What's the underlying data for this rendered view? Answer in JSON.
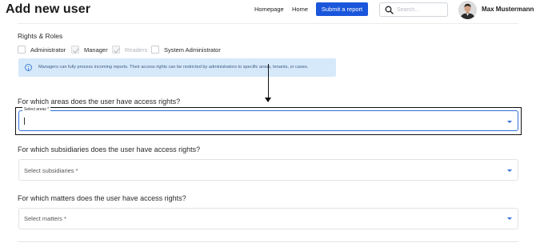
{
  "header": {
    "title": "Add new user",
    "nav": {
      "homepage": "Homepage",
      "home": "Home"
    },
    "submit_label": "Submit a report",
    "search_placeholder": "Search...",
    "user_name": "Max Mustermann"
  },
  "roles": {
    "title": "Rights & Roles",
    "items": [
      {
        "label": "Administrator",
        "checked": false,
        "disabled": false
      },
      {
        "label": "Manager",
        "checked": true,
        "disabled": true
      },
      {
        "label": "Readers",
        "checked": true,
        "disabled": true
      },
      {
        "label": "System Administrator",
        "checked": false,
        "disabled": false
      }
    ],
    "info": "Managers can fully process incoming reports. Their access rights can be restricted by administrators to specific areas, tenants, or cases."
  },
  "areas": {
    "question": "For which areas does the user have access rights?",
    "field_label": "Select areas *",
    "value": ""
  },
  "subsidiaries": {
    "question": "For which subsidiaries does the user have access rights?",
    "placeholder": "Select subsidiaries *"
  },
  "matters": {
    "question": "For which matters does the user have access rights?",
    "placeholder": "Select matters *"
  },
  "colors": {
    "accent": "#1a56db",
    "focus_border": "#2f6fd8",
    "info_bg": "#d6e9fb",
    "annotation": "#111111"
  },
  "icons": [
    "search-icon",
    "info-icon",
    "chevron-down-icon",
    "avatar"
  ]
}
